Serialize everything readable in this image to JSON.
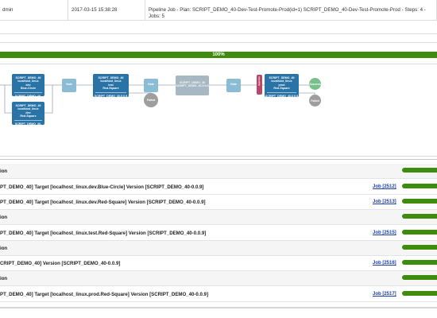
{
  "header_row": {
    "user": "dmin",
    "date": "2017-03-15 15:38:28",
    "description": "Pipeline Job - Plan: SCRIPT_DEMO_40-Dev-Test-Promote-Prod(id=1) SCRIPT_DEMO_40-Dev-Test-Promote-Prod - Steps: 4 - Jobs: 5"
  },
  "progress": {
    "percent": 100,
    "label": "100%",
    "color": "#3e8b0e"
  },
  "diagram": {
    "nodes": [
      {
        "l1": "SCRIPT_DEMO_40",
        "l2": "localhost_linux",
        "l3": "dev",
        "l4": "Blue-Circle",
        "foot": "SCRIPT_DEMO_40-0.0.9"
      },
      {
        "l1": "SCRIPT_DEMO_40",
        "l2": "localhost_linux",
        "l3": "dev",
        "l4": "Red-Square",
        "foot": "SCRIPT_DEMO_40-0.0.9"
      },
      {
        "l1": "SCRIPT_DEMO_40",
        "l2": "localhost_linux",
        "l3": "test",
        "l4": "Red-Square",
        "foot": "SCRIPT_DEMO_40-0.0.9"
      },
      {
        "l1": "SCRIPT_DEMO_40",
        "l2": "SCRIPT_DEMO_40-0.0.9",
        "l3": "",
        "l4": "",
        "foot": ""
      },
      {
        "l1": "SCRIPT_DEMO_40",
        "l2": "localhost_linux",
        "l3": "prod",
        "l4": "Red-Square",
        "foot": "SCRIPT_DEMO_40-0.0.9"
      }
    ],
    "gate_label": "Gate",
    "approve_label": "Approve",
    "success_label": "Success",
    "failure_label": "Failed"
  },
  "jobs": [
    {
      "text": "ion",
      "link": ""
    },
    {
      "text": "PT_DEMO_40] Target [localhost_linux.dev.Blue-Circle] Version [SCRIPT_DEMO_40-0.0.9]",
      "link": "Job [2512]"
    },
    {
      "text": "PT_DEMO_40] Target [localhost_linux.dev.Red-Square] Version [SCRIPT_DEMO_40-0.0.9]",
      "link": "Job [2513]"
    },
    {
      "text": "ion",
      "link": ""
    },
    {
      "text": "PT_DEMO_40] Target [localhost_linux.test.Red-Square] Version [SCRIPT_DEMO_40-0.0.9]",
      "link": "Job [2515]"
    },
    {
      "text": "ion",
      "link": ""
    },
    {
      "text": "CRIPT_DEMO_40] Version [SCRIPT_DEMO_40-0.0.9]",
      "link": "Job [2516]"
    },
    {
      "text": "ion",
      "link": ""
    },
    {
      "text": "PT_DEMO_40] Target [localhost_linux.prod.Red-Square] Version [SCRIPT_DEMO_40-0.0.9]",
      "link": "Job [2517]"
    }
  ]
}
